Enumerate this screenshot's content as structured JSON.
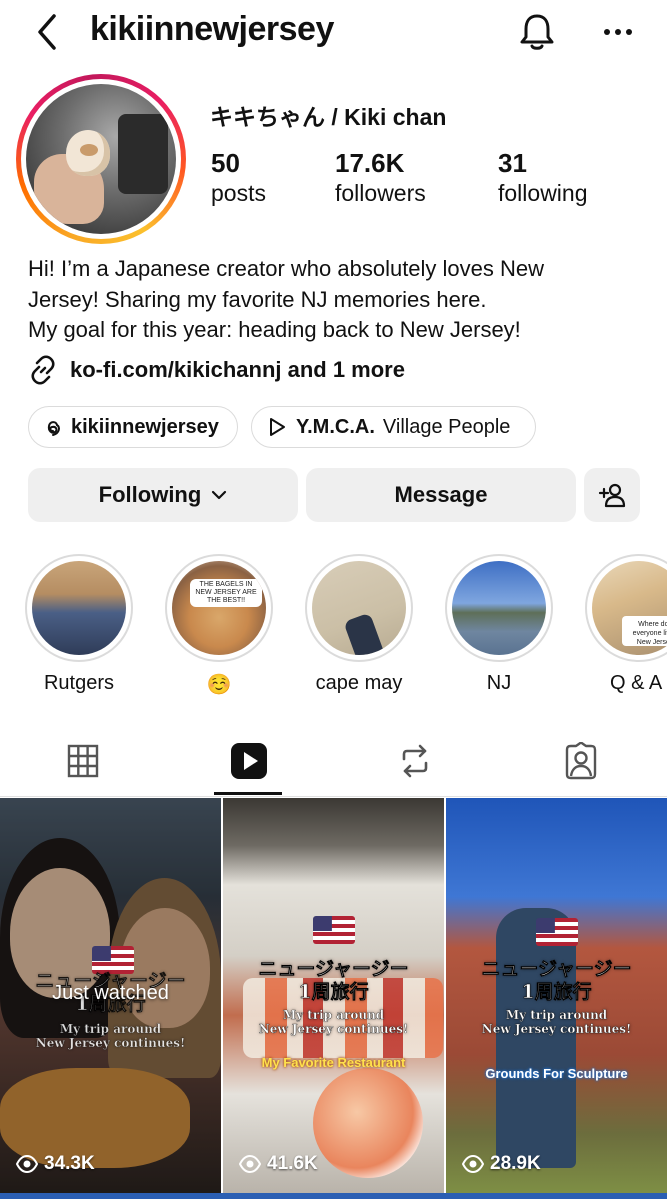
{
  "header": {
    "username": "kikiinnewjersey"
  },
  "profile": {
    "display_name": "キキちゃん / Kiki chan",
    "stats": {
      "posts": {
        "value": "50",
        "label": "posts"
      },
      "followers": {
        "value": "17.6K",
        "label": "followers"
      },
      "following": {
        "value": "31",
        "label": "following"
      }
    },
    "bio_lines": [
      "Hi! I’m a Japanese creator who absolutely loves New",
      "Jersey! Sharing my favorite NJ memories here.",
      "My goal for this year: heading back to New Jersey!"
    ],
    "link_text": "ko-fi.com/kikichannj and 1 more",
    "threads_chip": "kikiinnewjersey",
    "music_chip": {
      "title": "Y.M.C.A.",
      "artist": "Village People"
    }
  },
  "actions": {
    "following_label": "Following",
    "message_label": "Message"
  },
  "highlights": [
    {
      "label": "Rutgers"
    },
    {
      "label": "☺️"
    },
    {
      "label": "cape may"
    },
    {
      "label": "NJ"
    },
    {
      "label": "Q & A"
    }
  ],
  "highlight_thumb_text": {
    "bagels": "THE BAGELS IN NEW JERSEY ARE THE BEST!!",
    "qa": "Where does everyone live in New Jersey?"
  },
  "reels": [
    {
      "title": "ニュージャージー\n1周旅行",
      "subtitle": "My trip around\nNew Jersey continues!",
      "tag": "",
      "status": "Just watched",
      "views": "34.3K"
    },
    {
      "title": "ニュージャージー\n1周旅行",
      "subtitle": "My trip around\nNew Jersey continues!",
      "tag": "My Favorite Restaurant",
      "status": "",
      "views": "41.6K"
    },
    {
      "title": "ニュージャージー\n1周旅行",
      "subtitle": "My trip around\nNew Jersey continues!",
      "tag": "Grounds For Sculpture",
      "status": "",
      "views": "28.9K"
    }
  ],
  "colors": {
    "button_bg": "#efefef",
    "story_ring": [
      "#f9a825",
      "#ff6d00",
      "#e91e63"
    ]
  }
}
